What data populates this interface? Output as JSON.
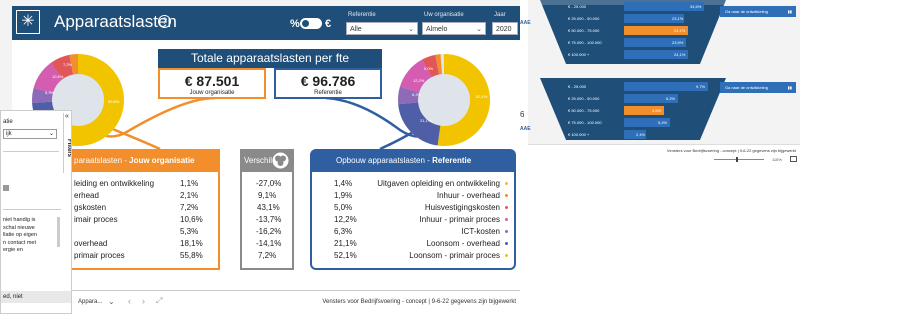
{
  "header": {
    "title": "Apparaatslasten",
    "help_icon": "?",
    "toggle_left": "%",
    "toggle_right": "€",
    "filters": [
      {
        "label": "Referentie",
        "value": "Alle"
      },
      {
        "label": "Uw organisatie",
        "value": "Almelo"
      },
      {
        "label": "Jaar",
        "value": "2020"
      }
    ]
  },
  "kpi": {
    "banner": "Totale apparaatslasten per fte",
    "own_value": "€ 87.501",
    "own_label": "Jouw organisatie",
    "ref_value": "€ 96.786",
    "ref_label": "Referentie"
  },
  "panel_own": {
    "title_prefix": "paraatslasten - ",
    "title_bold": "Jouw organisatie",
    "rows": [
      {
        "name": "leiding en ontwikkeling",
        "value": "1,1%"
      },
      {
        "name": "erhead",
        "value": "2,1%"
      },
      {
        "name": "gskosten",
        "value": "7,2%"
      },
      {
        "name": "imair proces",
        "value": "10,6%"
      },
      {
        "name": "",
        "value": "5,3%"
      },
      {
        "name": "overhead",
        "value": "18,1%"
      },
      {
        "name": "primair proces",
        "value": "55,8%"
      }
    ]
  },
  "panel_diff": {
    "title": "Verschil",
    "rows": [
      "-27,0%",
      "9,1%",
      "43,1%",
      "-13,7%",
      "-16,2%",
      "-14,1%",
      "7,2%"
    ]
  },
  "panel_ref": {
    "title_prefix": "Opbouw apparaatslasten - ",
    "title_bold": "Referentie",
    "rows": [
      {
        "value": "1,4%",
        "name": "Uitgaven opleiding en ontwikkeling",
        "color": "#f4b942"
      },
      {
        "value": "1,9%",
        "name": "Inhuur - overhead",
        "color": "#f28e2b"
      },
      {
        "value": "5,0%",
        "name": "Huisvestigingskosten",
        "color": "#e15759"
      },
      {
        "value": "12,2%",
        "name": "Inhuur - primair proces",
        "color": "#d45db2"
      },
      {
        "value": "6,3%",
        "name": "ICT-kosten",
        "color": "#8e6bb8"
      },
      {
        "value": "21,1%",
        "name": "Loonsom - overhead",
        "color": "#4e5fa8"
      },
      {
        "value": "52,1%",
        "name": "Loonsom - primair proces",
        "color": "#f2c400"
      }
    ]
  },
  "donut_own": {
    "labels": [
      "1,1%",
      "2,1%",
      "7,2%",
      "10,6%",
      "5,3%",
      "18,1%",
      "55,8%"
    ]
  },
  "donut_ref": {
    "labels": [
      "1,4%",
      "1,9%",
      "5,0%",
      "12,2%",
      "6,3%",
      "21,1%",
      "52,1%"
    ]
  },
  "bottom": {
    "page_name": "Appara...",
    "footer": "Vensters voor Bedrijfsvoering - concept  |  9-6-22 gegevens zijn bijgewerkt"
  },
  "side_panel": {
    "heading": "atie",
    "dropdown": "ijk",
    "filters_label": "Filters",
    "text_lines": [
      "niet handig is",
      "schal nieuwe",
      "llatie op eigen",
      "n contact met",
      "ergie en"
    ],
    "footer_text": "ed, niet"
  },
  "thumbnail": {
    "bar_labels_1": [
      "€ - 25.000",
      "€ 25.000 - 50.000",
      "€ 50.000 - 75.000",
      "€ 75.000 - 100.000",
      "€ 100.000 +"
    ],
    "bar_values_1": [
      "34,6%",
      "23,1%",
      "24,1%",
      "23,9%",
      "24,1%"
    ],
    "bar_labels_2": [
      "€ - 25.000",
      "€ 25.000 - 50.000",
      "€ 50.000 - 75.000",
      "€ 75.000 - 100.000",
      "€ 100.000 +"
    ],
    "bar_values_2": [
      "9,7%",
      "6,2%",
      "4,6%",
      "5,4%",
      "2,4%"
    ],
    "button_label": "Ga naar de ontwikkeling",
    "side_letters": [
      "AAE",
      "6",
      "AAE"
    ],
    "footer": "Vensters voor Bedrijfsvoering - concept  |  9-6-22 gegevens zijn bijgewerkt",
    "zoom": "116%"
  }
}
